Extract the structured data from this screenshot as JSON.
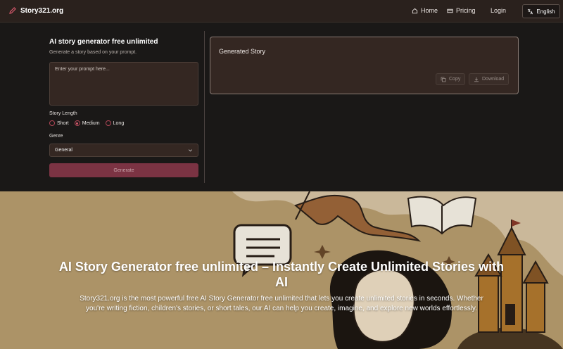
{
  "nav": {
    "brand": "Story321.org",
    "home": "Home",
    "pricing": "Pricing",
    "login": "Login",
    "language": "English"
  },
  "generator": {
    "title": "AI story generator free unlimited",
    "subtitle": "Generate a story based on your prompt.",
    "prompt_placeholder": "Enter your prompt here...",
    "length_label": "Story Length",
    "length_options": [
      "Short",
      "Medium",
      "Long"
    ],
    "length_selected": "Medium",
    "genre_label": "Genre",
    "genre_value": "General",
    "generate_label": "Generate"
  },
  "output": {
    "title": "Generated Story",
    "copy_label": "Copy",
    "download_label": "Download"
  },
  "hero": {
    "title": "AI Story Generator free unlimited – Instantly Create Unlimited Stories with AI",
    "description": "Story321.org is the most powerful free AI Story Generator free unlimited that lets you create unlimited stories in seconds. Whether you're writing fiction, children's stories, or short tales, our AI can help you create, imagine, and explore new worlds effortlessly."
  },
  "colors": {
    "accent": "#d2576a",
    "button": "#7b3343",
    "hero_bg": "#bba070"
  }
}
